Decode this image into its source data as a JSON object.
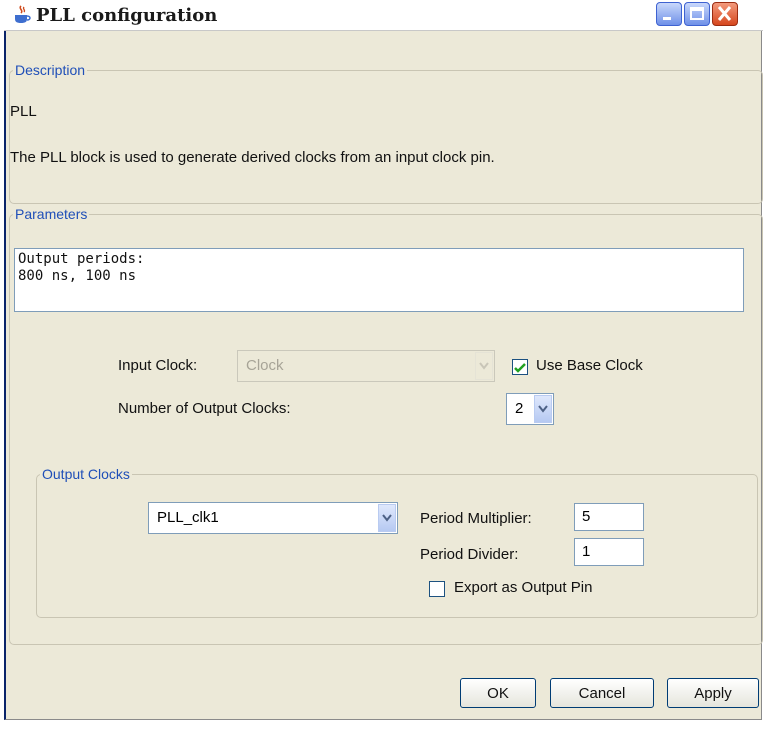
{
  "window": {
    "title": "PLL configuration",
    "icons": {
      "app": "java-cup-icon",
      "minimize": "minimize-icon",
      "maximize": "maximize-icon",
      "close": "close-icon"
    }
  },
  "description": {
    "legend": "Description",
    "name": "PLL",
    "text": "The PLL block is used to generate derived clocks from an input clock pin."
  },
  "parameters": {
    "legend": "Parameters",
    "line1": "Output periods:",
    "line2": "800 ns, 100 ns",
    "input_clock_label": "Input Clock:",
    "input_clock_value": "Clock",
    "use_base_clock_label": "Use Base Clock",
    "use_base_clock_checked": true,
    "num_outputs_label": "Number of Output Clocks:",
    "num_outputs_value": "2"
  },
  "output_clocks": {
    "legend": "Output Clocks",
    "selected_clock": "PLL_clk1",
    "period_multiplier_label": "Period Multiplier:",
    "period_multiplier_value": "5",
    "period_divider_label": "Period Divider:",
    "period_divider_value": "1",
    "export_label": "Export as Output Pin",
    "export_checked": false
  },
  "buttons": {
    "ok": "OK",
    "cancel": "Cancel",
    "apply": "Apply"
  },
  "colors": {
    "legend": "#1f4fb8",
    "checkmark": "#21a121",
    "face": "#ece9d8"
  }
}
